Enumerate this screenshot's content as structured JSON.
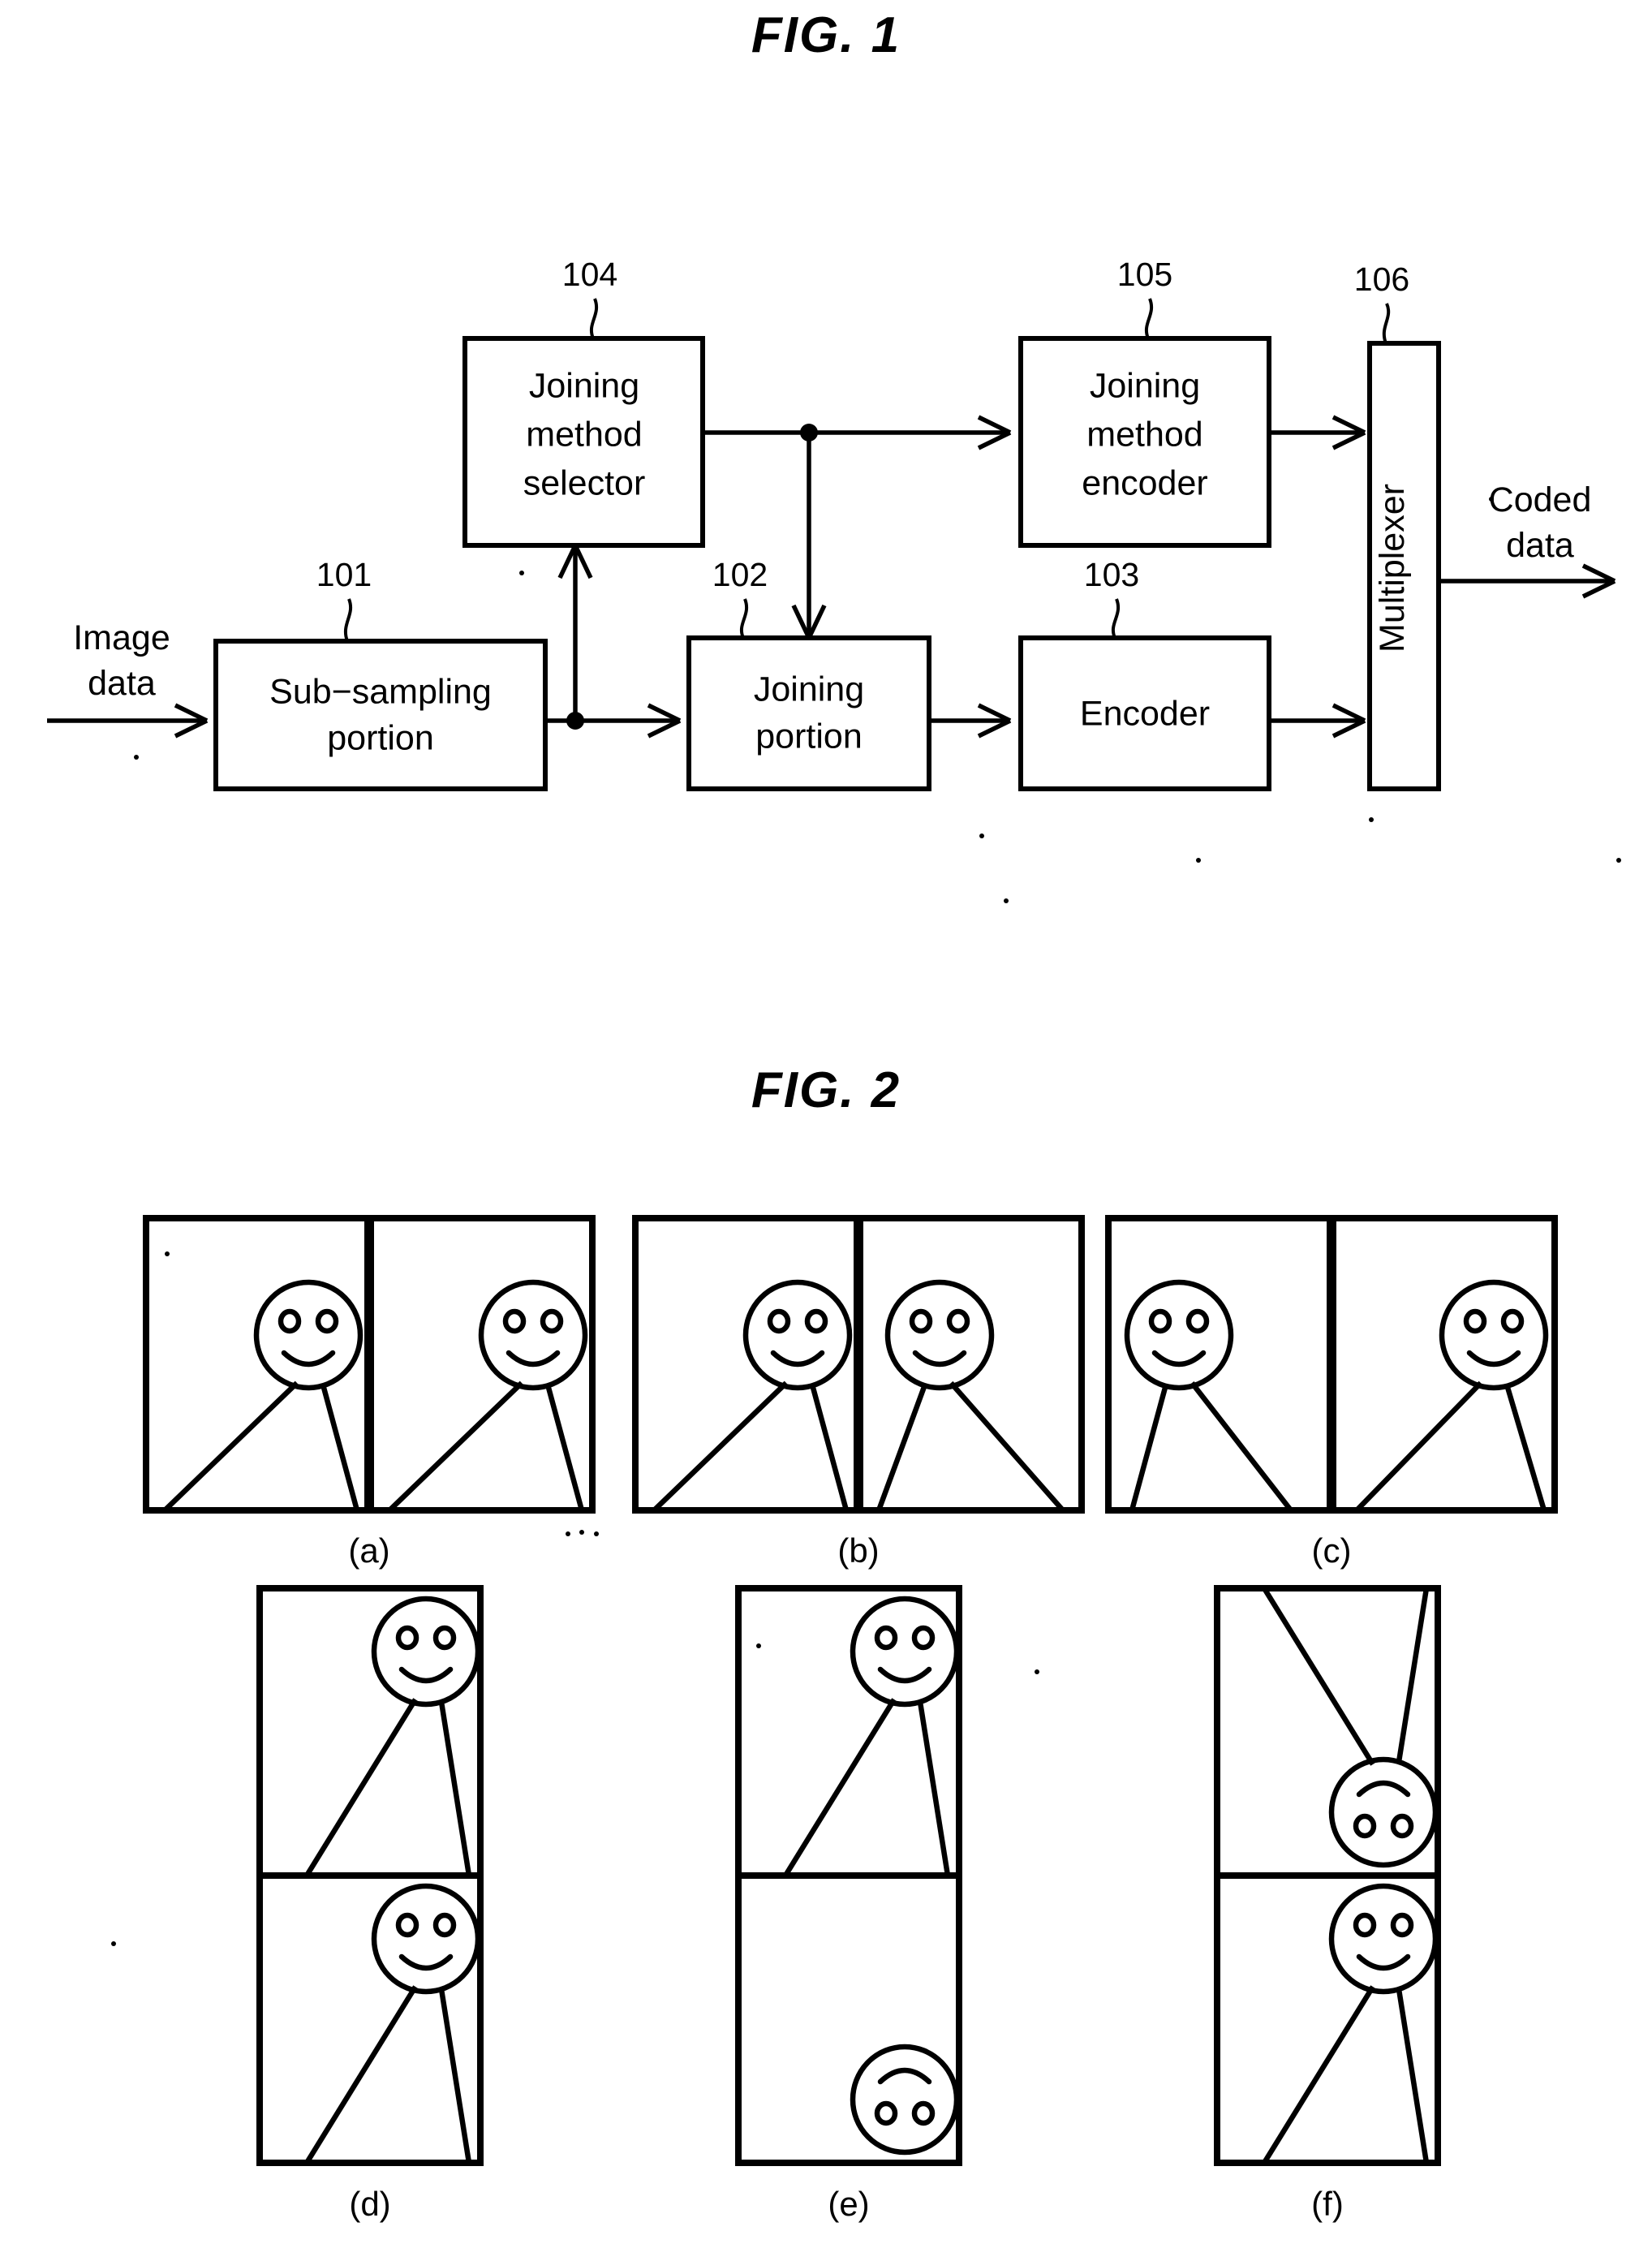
{
  "figures": {
    "fig1": {
      "title": "FIG.  1",
      "blocks": [
        {
          "id": "sub_sampling",
          "ref": "101",
          "label_line1": "Sub−sampling",
          "label_line2": "portion"
        },
        {
          "id": "joining_portion",
          "ref": "102",
          "label_line1": "Joining",
          "label_line2": "portion"
        },
        {
          "id": "encoder",
          "ref": "103",
          "label_line1": "Encoder",
          "label_line2": ""
        },
        {
          "id": "joining_method_selector",
          "ref": "104",
          "label_line1": "Joining",
          "label_line2": "method",
          "label_line3": "selector"
        },
        {
          "id": "joining_method_encoder",
          "ref": "105",
          "label_line1": "Joining",
          "label_line2": "method",
          "label_line3": "encoder"
        },
        {
          "id": "multiplexer",
          "ref": "106",
          "label_line1": "Multiplexer",
          "label_line2": ""
        }
      ],
      "io": {
        "input_line1": "Image",
        "input_line2": "data",
        "output_line1": "Coded",
        "output_line2": "data"
      }
    },
    "fig2": {
      "title": "FIG.  2",
      "panels": [
        {
          "id": "a",
          "label": "(a)",
          "orientation": "horizontal",
          "frames": [
            {
              "face_x": 0.62,
              "flipped": false
            },
            {
              "face_x": 0.62,
              "flipped": false
            }
          ]
        },
        {
          "id": "b",
          "label": "(b)",
          "orientation": "horizontal",
          "frames": [
            {
              "face_x": 0.62,
              "flipped": false
            },
            {
              "face_x": 0.36,
              "flipped": false
            }
          ]
        },
        {
          "id": "c",
          "label": "(c)",
          "orientation": "horizontal",
          "frames": [
            {
              "face_x": 0.3,
              "flipped": false
            },
            {
              "face_x": 0.7,
              "flipped": false
            }
          ]
        },
        {
          "id": "d",
          "label": "(d)",
          "orientation": "vertical",
          "frames": [
            {
              "face_x": 0.64,
              "flipped": false
            },
            {
              "face_x": 0.64,
              "flipped": false
            }
          ]
        },
        {
          "id": "e",
          "label": "(e)",
          "orientation": "vertical",
          "frames": [
            {
              "face_x": 0.64,
              "flipped": false
            },
            {
              "face_x": 0.64,
              "flipped": true
            }
          ]
        },
        {
          "id": "f",
          "label": "(f)",
          "orientation": "vertical",
          "frames": [
            {
              "face_x": 0.64,
              "flipped": true
            },
            {
              "face_x": 0.64,
              "flipped": false
            }
          ]
        }
      ]
    }
  }
}
